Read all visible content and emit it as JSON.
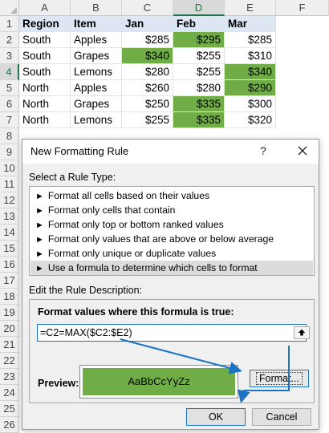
{
  "sheet": {
    "columns": [
      "A",
      "B",
      "C",
      "D",
      "E",
      "F"
    ],
    "rows": [
      "1",
      "2",
      "3",
      "4",
      "5",
      "6",
      "7",
      "8",
      "9",
      "10",
      "11",
      "12",
      "13",
      "14",
      "15",
      "16",
      "17",
      "18",
      "19",
      "20",
      "21",
      "22",
      "23",
      "24",
      "25",
      "26"
    ],
    "headers": [
      "Region",
      "Item",
      "Jan",
      "Feb",
      "Mar"
    ],
    "data": [
      [
        "South",
        "Apples",
        "$285",
        "$295",
        "$285"
      ],
      [
        "South",
        "Grapes",
        "$340",
        "$255",
        "$310"
      ],
      [
        "South",
        "Lemons",
        "$280",
        "$255",
        "$340"
      ],
      [
        "North",
        "Apples",
        "$260",
        "$280",
        "$290"
      ],
      [
        "North",
        "Grapes",
        "$250",
        "$335",
        "$300"
      ],
      [
        "North",
        "Lemons",
        "$255",
        "$335",
        "$320"
      ]
    ],
    "highlight_color": "#70ad47"
  },
  "dialog": {
    "title": "New Formatting Rule",
    "help": "?",
    "select_rule_label": "Select a Rule Type:",
    "rule_types": [
      "Format all cells based on their values",
      "Format only cells that contain",
      "Format only top or bottom ranked values",
      "Format only values that are above or below average",
      "Format only unique or duplicate values",
      "Use a formula to determine which cells to format"
    ],
    "selected_rule_index": 5,
    "edit_label": "Edit the Rule Description:",
    "formula_label": "Format values where this formula is true:",
    "formula_value": "=C2=MAX($C2:$E2)",
    "preview_label": "Preview:",
    "preview_text": "AaBbCcYyZz",
    "preview_color": "#70ad47",
    "format_button": "Format...",
    "ok_button": "OK",
    "cancel_button": "Cancel",
    "accent_color": "#1a73c4"
  }
}
